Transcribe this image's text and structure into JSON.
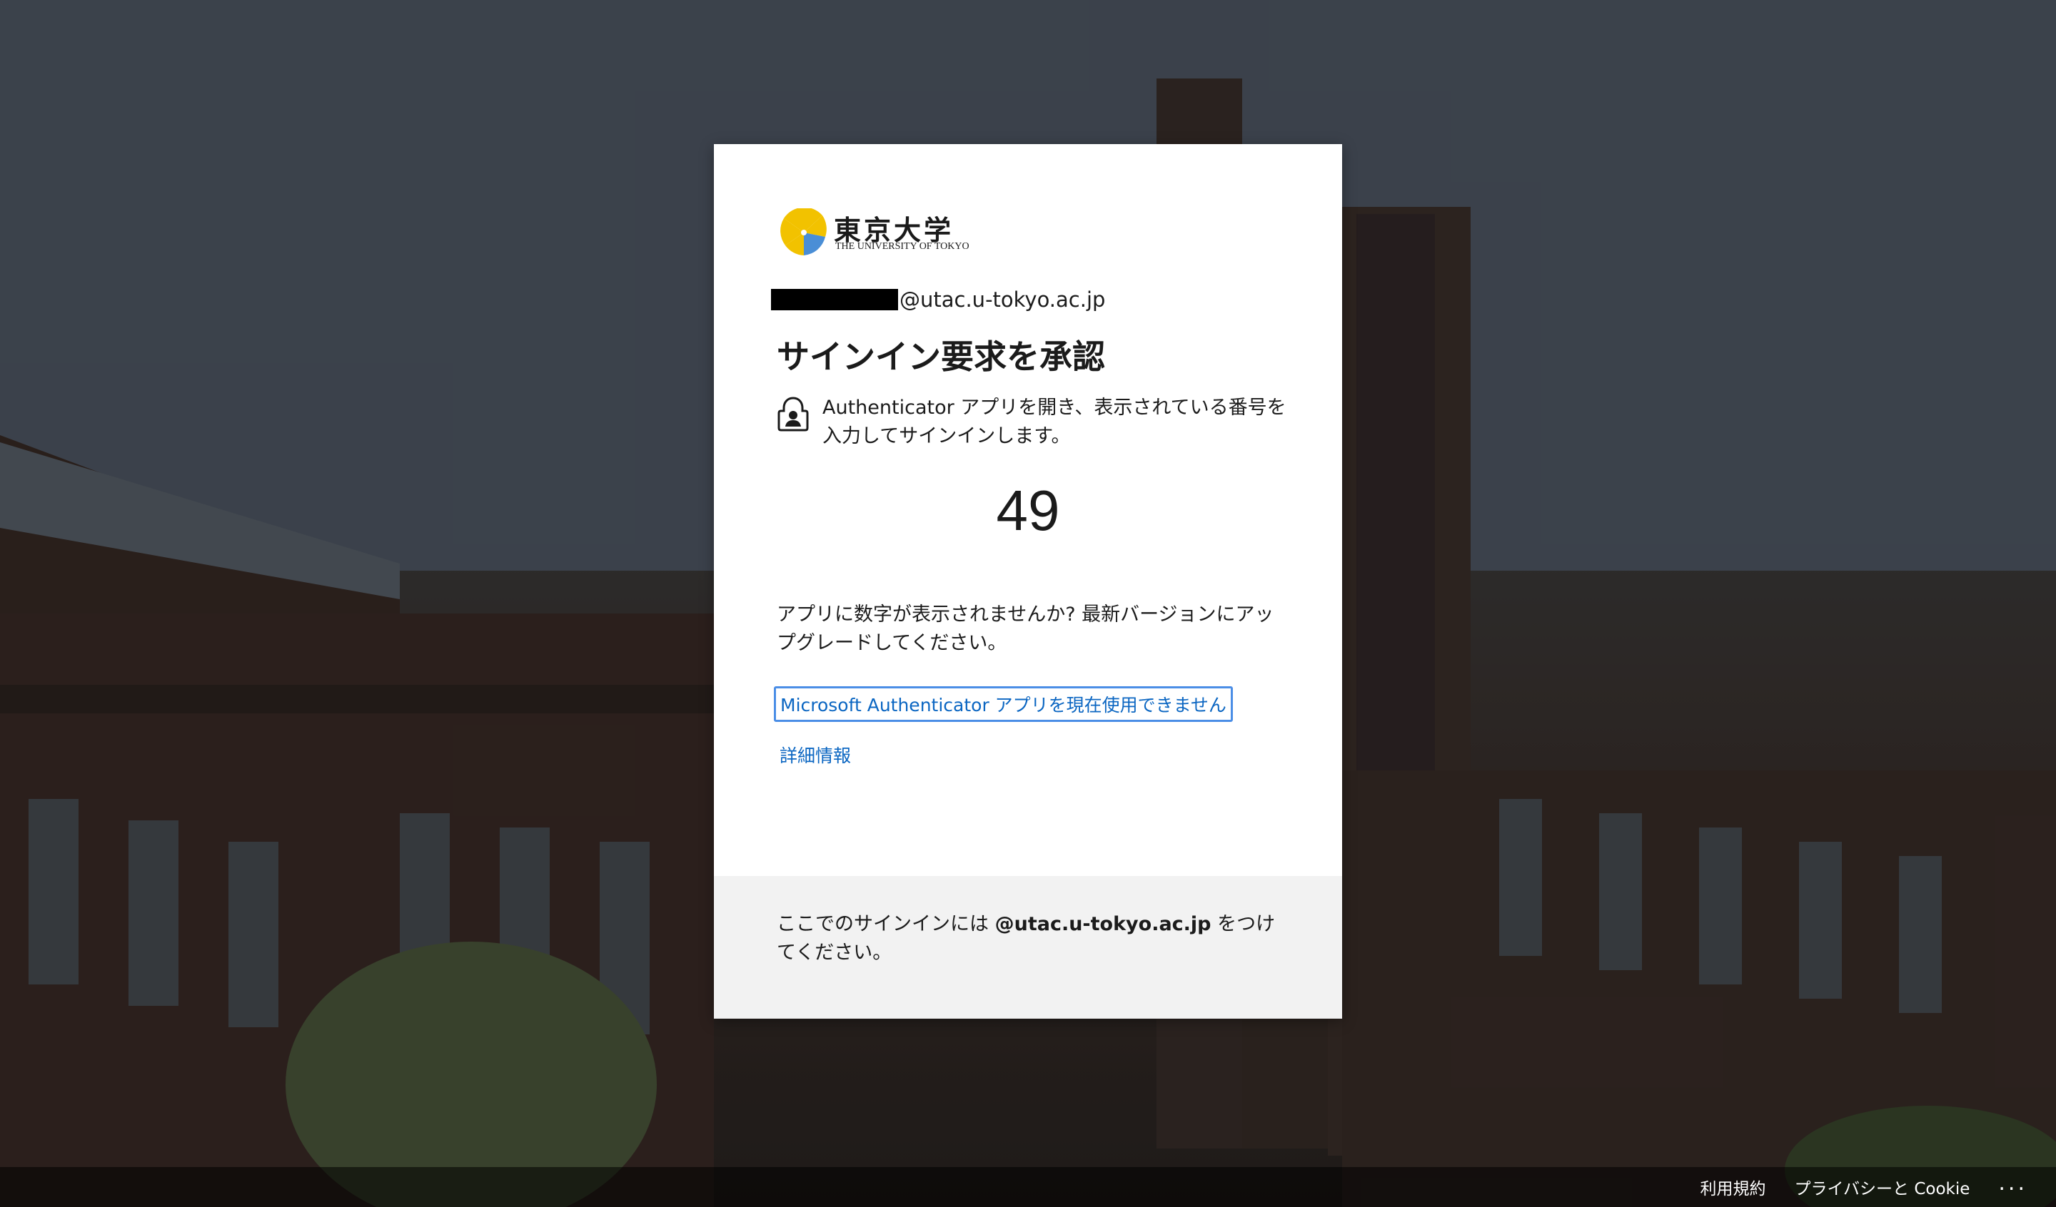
{
  "logo": {
    "name_ja": "東京大学",
    "name_en": "THE UNIVERSITY OF TOKYO",
    "icon": "ginkgo-leaf-logo"
  },
  "identity": {
    "email_suffix": "@utac.u-tokyo.ac.jp",
    "redacted": true
  },
  "title": "サインイン要求を承認",
  "instruction": {
    "icon": "authenticator-lock-icon",
    "text": "Authenticator アプリを開き、表示されている番号を入力してサインインします。"
  },
  "code": "49",
  "upgrade_text": "アプリに数字が表示されませんか? 最新バージョンにアップグレードしてください。",
  "links": {
    "cannot_use": "Microsoft Authenticator アプリを現在使用できません",
    "details": "詳細情報"
  },
  "footer": {
    "prefix": "ここでのサインインには ",
    "domain": "@utac.u-tokyo.ac.jp",
    "suffix": " をつけてください。"
  },
  "bottom_bar": {
    "terms": "利用規約",
    "privacy": "プライバシーと Cookie",
    "more": "..."
  },
  "colors": {
    "link": "#0b66c2",
    "focus_outline": "#4b8ee6",
    "footer_bg": "#f2f2f2",
    "logo_yellow": "#f2c200",
    "logo_blue": "#4a8ed6"
  }
}
